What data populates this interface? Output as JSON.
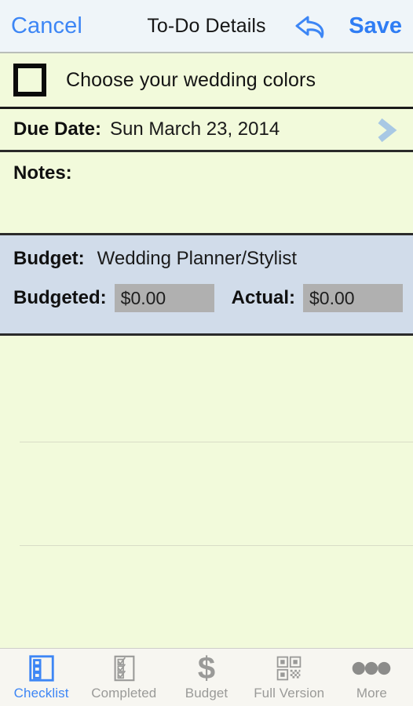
{
  "navbar": {
    "cancel_label": "Cancel",
    "title": "To-Do Details",
    "undo_icon": "undo-arrow-icon",
    "save_label": "Save",
    "cancel_color": "#3D86F5",
    "save_color": "#2F7DF4",
    "background": "#EFF5F9"
  },
  "task": {
    "checkbox_icon": "checkbox-unchecked-icon",
    "checked": false,
    "title": "Choose your wedding colors"
  },
  "due_date": {
    "label": "Due Date:",
    "value": "Sun March 23, 2014",
    "chevron_icon": "chevron-right-icon",
    "chevron_color": "#A8C8E4"
  },
  "notes": {
    "label": "Notes:",
    "value": "",
    "placeholder": ""
  },
  "budget": {
    "label": "Budget:",
    "category": "Wedding Planner/Stylist",
    "budgeted_label": "Budgeted:",
    "budgeted_value": "$0.00",
    "actual_label": "Actual:",
    "actual_value": "$0.00",
    "panel_color": "#D1DCEA",
    "field_color": "#B0B0B0"
  },
  "page": {
    "background": "#F2FADB",
    "divider_color": "#2A2A2A"
  },
  "tabbar": {
    "background": "#F7F6F1",
    "active_color": "#3D86F5",
    "inactive_color": "#9A9A98",
    "items": [
      {
        "label": "Checklist",
        "icon": "checklist-icon",
        "active": true
      },
      {
        "label": "Completed",
        "icon": "completed-list-icon",
        "active": false
      },
      {
        "label": "Budget",
        "icon": "dollar-sign-icon",
        "active": false
      },
      {
        "label": "Full Version",
        "icon": "qr-code-icon",
        "active": false
      },
      {
        "label": "More",
        "icon": "more-dots-icon",
        "active": false
      }
    ]
  }
}
